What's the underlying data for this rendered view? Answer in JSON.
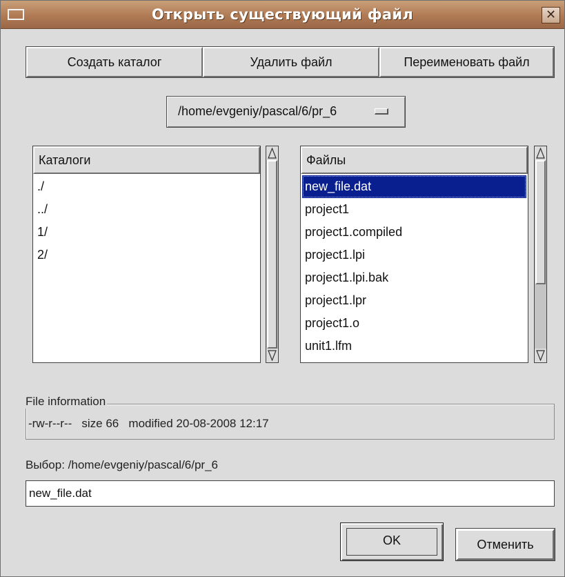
{
  "window": {
    "title": "Открыть существующий файл",
    "close_glyph": "✕"
  },
  "toolbar": {
    "create_dir": "Создать каталог",
    "delete_file": "Удалить файл",
    "rename_file": "Переименовать файл"
  },
  "path_selector": {
    "value": "/home/evgeniy/pascal/6/pr_6"
  },
  "directories": {
    "header": "Каталоги",
    "items": [
      "./",
      "../",
      "1/",
      "2/"
    ]
  },
  "files": {
    "header": "Файлы",
    "selected_index": 0,
    "items": [
      "new_file.dat",
      "project1",
      "project1.compiled",
      "project1.lpi",
      "project1.lpi.bak",
      "project1.lpr",
      "project1.o",
      "unit1.lfm"
    ]
  },
  "file_info": {
    "legend": "File information",
    "text": "-rw-r--r--   size 66   modified 20-08-2008 12:17"
  },
  "selection": {
    "label": "Выбор: /home/evgeniy/pascal/6/pr_6",
    "value": "new_file.dat"
  },
  "buttons": {
    "ok": "OK",
    "cancel": "Отменить"
  },
  "colors": {
    "titlebar": "#b07a54",
    "selection": "#0a1f8f",
    "background": "#dcdcdc"
  }
}
